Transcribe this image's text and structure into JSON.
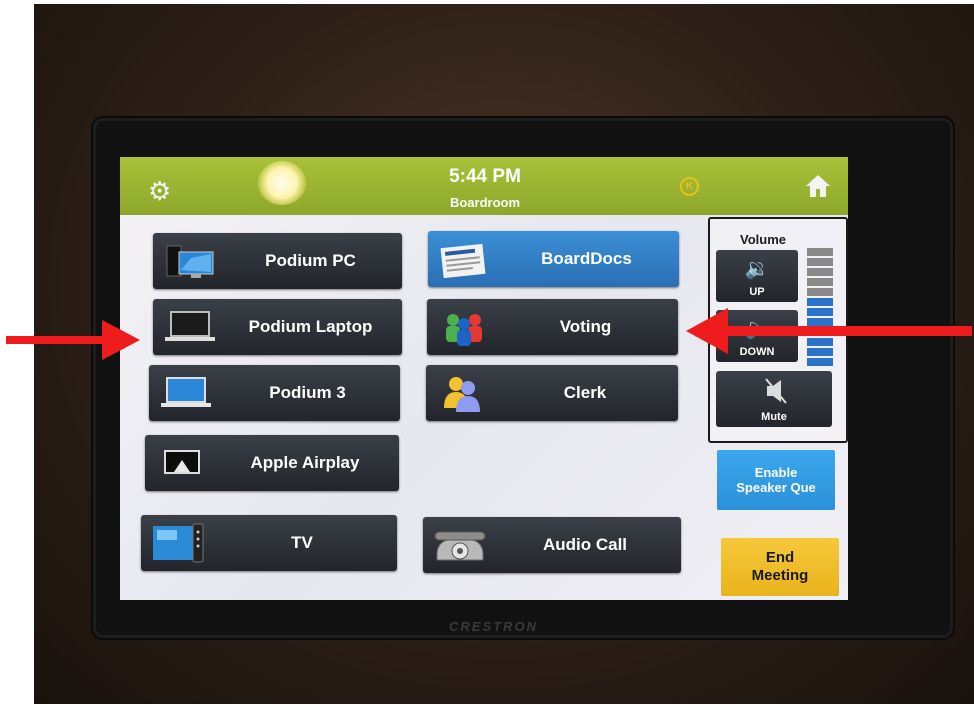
{
  "header": {
    "time": "5:44 PM",
    "room": "Boardroom"
  },
  "sources": [
    {
      "label": "Podium PC",
      "icon": "desktop-pc-icon"
    },
    {
      "label": "Podium Laptop",
      "icon": "laptop-icon"
    },
    {
      "label": "Podium 3",
      "icon": "laptop-icon"
    },
    {
      "label": "Apple Airplay",
      "icon": "airplay-icon"
    },
    {
      "label": "TV",
      "icon": "tv-remote-icon"
    }
  ],
  "apps": [
    {
      "label": "BoardDocs",
      "icon": "newspaper-icon",
      "selected": true
    },
    {
      "label": "Voting",
      "icon": "people-group-icon"
    },
    {
      "label": "Clerk",
      "icon": "users-icon"
    },
    {
      "label": "Audio Call",
      "icon": "telephone-icon"
    }
  ],
  "volume": {
    "title": "Volume",
    "up_label": "UP",
    "down_label": "DOWN",
    "mute_label": "Mute",
    "level_fraction": 0.58
  },
  "speaker_queue": {
    "line1": "Enable",
    "line2": "Speaker Que"
  },
  "end_meeting": {
    "line1": "End",
    "line2": "Meeting"
  },
  "brand": "CRESTRON",
  "colors": {
    "header_green": "#9bb532",
    "accent_blue": "#2f86d2",
    "end_meeting_yellow": "#f2c12e",
    "annotation_red": "#ee1c1c"
  }
}
